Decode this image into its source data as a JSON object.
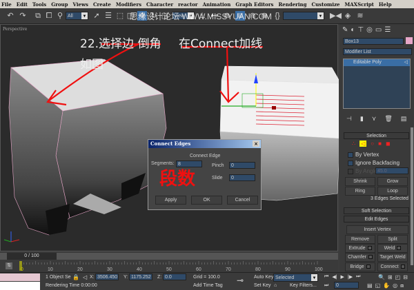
{
  "menu": [
    "File",
    "Edit",
    "Tools",
    "Group",
    "Views",
    "Create",
    "Modifiers",
    "Character",
    "reactor",
    "Animation",
    "Graph Editors",
    "Rendering",
    "Customize",
    "MAXScript",
    "Help"
  ],
  "toolbar": {
    "selection_filter": "All",
    "view_dropdown": "View",
    "named_selection": "",
    "watermark": "思缘设计论坛 WWW.MISSYUAN.COM"
  },
  "viewport": {
    "label": "Perspective",
    "annotation_1": "22.选择边 倒角",
    "annotation_2": "如图",
    "annotation_3": "在Connect加线",
    "annotation_dialog": "段数",
    "annotation_color": "#ff1010"
  },
  "dialog": {
    "title": "Connect Edges",
    "group": "Connect Edge",
    "segments_label": "Segments:",
    "segments": "8",
    "pinch_label": "Pinch",
    "pinch": "0",
    "slide_label": "Slide",
    "slide": "0",
    "apply": "Apply",
    "ok": "OK",
    "cancel": "Cancel"
  },
  "command_panel": {
    "object_name": "Box13",
    "object_color": "#e6a6c8",
    "modifier_list": "Modifier List",
    "stack": [
      "Editable Poly"
    ],
    "selection": {
      "title": "Selection",
      "by_vertex": "By Vertex",
      "ignore_backfacing": "Ignore Backfacing",
      "by_angle": "By Angle:",
      "angle": "45.0",
      "shrink": "Shrink",
      "grow": "Grow",
      "ring": "Ring",
      "loop": "Loop",
      "info": "3 Edges Selected"
    },
    "soft_selection": "Soft Selection",
    "edit_edges": {
      "title": "Edit Edges",
      "insert_vertex": "Insert Vertex",
      "remove": "Remove",
      "split": "Split",
      "extrude": "Extrude",
      "weld": "Weld",
      "chamfer": "Chamfer",
      "target_weld": "Target Weld",
      "bridge": "Bridge",
      "connect": "Connect"
    }
  },
  "timeline": {
    "frame": "0 / 100",
    "ticks": [
      "0",
      "10",
      "20",
      "30",
      "40",
      "50",
      "60",
      "70",
      "80",
      "90",
      "100"
    ]
  },
  "status": {
    "selected": "1 Object Se",
    "x_label": "X:",
    "x": "3506.450",
    "y_label": "Y:",
    "y": "1175.252",
    "z_label": "Z:",
    "z": "0.0",
    "grid": "Grid = 100.0",
    "rendering_time": "Rendering Time  0:00:00",
    "add_time_tag": "Add Time Tag",
    "auto_key": "Auto Key",
    "set_key": "Set Key",
    "key_mode": "Selected",
    "key_filters": "Key Filters...",
    "current_frame": "0"
  }
}
